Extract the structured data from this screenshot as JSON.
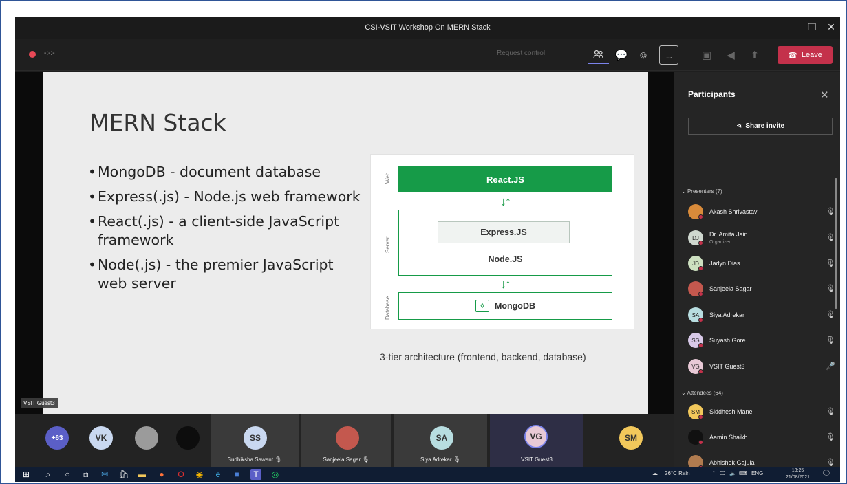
{
  "window": {
    "title": "CSI-VSIT Workshop On MERN Stack",
    "minimize_icon": "minimize-icon",
    "maximize_icon": "maximize-icon",
    "close_icon": "close-icon"
  },
  "toolbar": {
    "timer": "-:-:-",
    "request_control": "Request control",
    "leave_label": "Leave",
    "more_label": "...",
    "colors": {
      "leave": "#c4314b",
      "recording": "#e74856",
      "accent": "#7b83eb"
    }
  },
  "slide": {
    "title": "MERN Stack",
    "bullets": [
      "MongoDB - document database",
      "Express(.js) - Node.js web framework",
      "React(.js) - a client-side JavaScript framework",
      "Node(.js) - the premier JavaScript web server"
    ],
    "diagram": {
      "tiers": [
        "Web",
        "Server",
        "Database"
      ],
      "web_box": "React.JS",
      "express_box": "Express.JS",
      "node_label": "Node.JS",
      "db_box": "MongoDB",
      "arrows": "↓↑",
      "accent_color": "#169b48"
    },
    "caption": "3-tier architecture (frontend, backend, database)"
  },
  "stage": {
    "name_tag": "VSIT Guest3"
  },
  "participants_panel": {
    "title": "Participants",
    "share_invite": "Share invite",
    "presenters_header": "Presenters (7)",
    "attendees_header": "Attendees (64)",
    "presenters": [
      {
        "name": "Akash Shrivastav",
        "initials": "",
        "sub": "",
        "avatar_color": "#d98b3a"
      },
      {
        "name": "Dr. Amita Jain",
        "initials": "DJ",
        "sub": "Organizer",
        "avatar_color": "#cfd8cf"
      },
      {
        "name": "Jadyn Dias",
        "initials": "JD",
        "sub": "",
        "avatar_color": "#cde0c0"
      },
      {
        "name": "Sanjeela Sagar",
        "initials": "",
        "sub": "",
        "avatar_color": "#c4584e"
      },
      {
        "name": "Siya Adrekar",
        "initials": "SA",
        "sub": "",
        "avatar_color": "#b7dde0"
      },
      {
        "name": "Suyash Gore",
        "initials": "SG",
        "sub": "",
        "avatar_color": "#d8c9e8"
      },
      {
        "name": "VSIT Guest3",
        "initials": "VG",
        "sub": "",
        "avatar_color": "#e8c9d6"
      }
    ],
    "attendees": [
      {
        "name": "Siddhesh Mane",
        "initials": "SM",
        "sub": "",
        "avatar_color": "#f2c85b"
      },
      {
        "name": "Aamin Shaikh",
        "initials": "",
        "sub": "",
        "avatar_color": "#111111"
      },
      {
        "name": "Abhishek Gajula",
        "initials": "",
        "sub": "",
        "avatar_color": "#b07b4f"
      }
    ]
  },
  "strip": {
    "overflow": "+63",
    "tiles": [
      {
        "initials": "VK",
        "name": "",
        "avatar_color": "#c9d8f0"
      },
      {
        "initials": "",
        "name": "",
        "avatar_color": "#9b9b9b"
      },
      {
        "initials": "",
        "name": "",
        "avatar_color": "#0d0d0d"
      },
      {
        "initials": "SS",
        "name": "Sudhiksha Sawant",
        "avatar_color": "#c9d8f0"
      },
      {
        "initials": "",
        "name": "Sanjeela Sagar",
        "avatar_color": "#c4584e"
      },
      {
        "initials": "SA",
        "name": "Siya Adrekar",
        "avatar_color": "#b7dde0"
      },
      {
        "initials": "VG",
        "name": "VSIT Guest3",
        "avatar_color": "#e8c9d6"
      },
      {
        "initials": "SM",
        "name": "",
        "avatar_color": "#f2c85b"
      }
    ]
  },
  "taskbar": {
    "weather": "26°C Rain",
    "language": "ENG",
    "time": "13:25",
    "date": "21/08/2021"
  }
}
